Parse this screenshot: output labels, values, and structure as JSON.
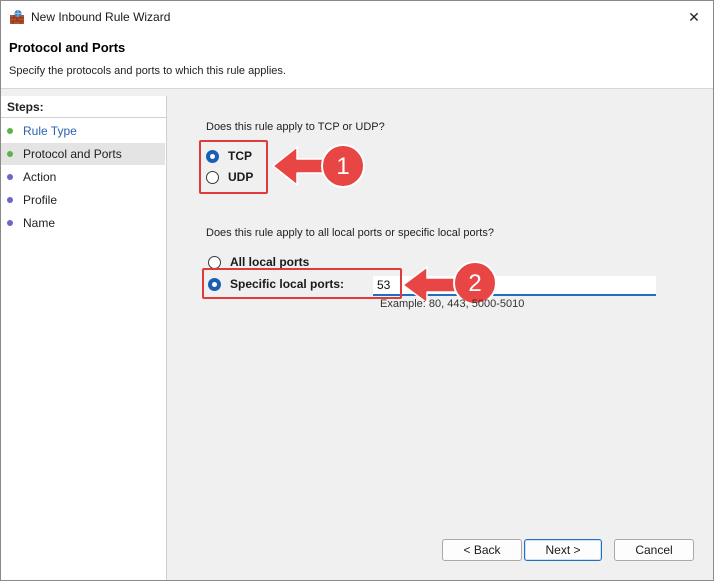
{
  "window": {
    "title": "New Inbound Rule Wizard",
    "close_glyph": "✕"
  },
  "header": {
    "title": "Protocol and Ports",
    "description": "Specify the protocols and ports to which this rule applies."
  },
  "steps": {
    "label": "Steps:",
    "items": [
      {
        "label": "Rule Type",
        "status": "done"
      },
      {
        "label": "Protocol and Ports",
        "status": "current"
      },
      {
        "label": "Action",
        "status": "pending"
      },
      {
        "label": "Profile",
        "status": "pending"
      },
      {
        "label": "Name",
        "status": "pending"
      }
    ]
  },
  "protocol": {
    "question": "Does this rule apply to TCP or UDP?",
    "options": [
      {
        "label": "TCP",
        "checked": true
      },
      {
        "label": "UDP",
        "checked": false
      }
    ]
  },
  "ports": {
    "question": "Does this rule apply to all local ports or specific local ports?",
    "options": [
      {
        "label": "All local ports",
        "checked": false
      },
      {
        "label": "Specific local ports:",
        "checked": true
      }
    ],
    "value": "53",
    "example": "Example: 80, 443, 5000-5010"
  },
  "annotations": [
    {
      "number": "1"
    },
    {
      "number": "2"
    }
  ],
  "buttons": {
    "back": "< Back",
    "next": "Next >",
    "cancel": "Cancel"
  },
  "colors": {
    "accent": "#1a5fb4",
    "annotation": "#e03a3a",
    "done_dot": "#5fb14b",
    "pending_dot": "#6b66c9"
  }
}
